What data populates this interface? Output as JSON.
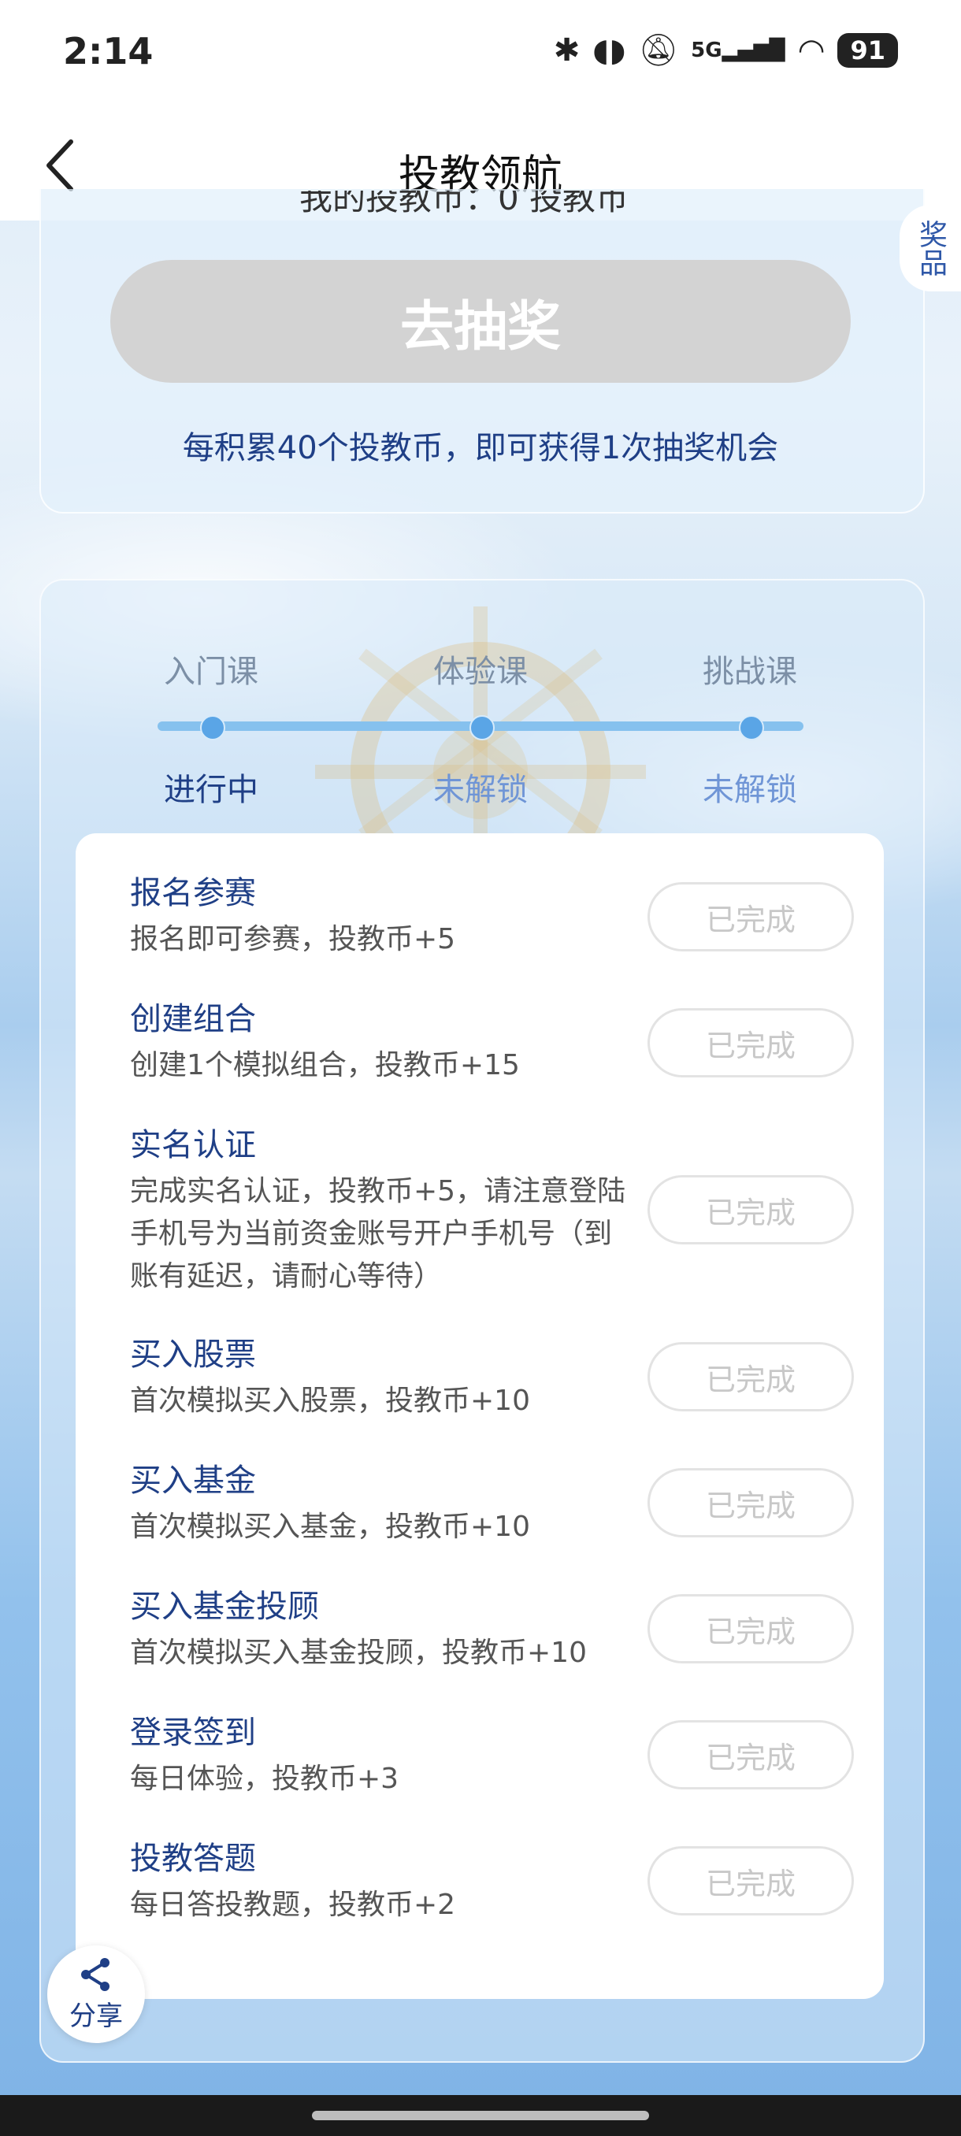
{
  "status_bar": {
    "time": "2:14",
    "icons": [
      "bluetooth-icon",
      "earbuds-icon",
      "mute-icon",
      "5g-signal-icon",
      "wifi-icon"
    ],
    "network": "5G",
    "battery": "91"
  },
  "navbar": {
    "title": "投教领航",
    "back_icon": "chevron-left-icon"
  },
  "draw": {
    "button_label": "去抽奖",
    "tip": "每积累40个投教币，即可获得1次抽奖机会",
    "clipped_text": "我的投教币：0 投教币",
    "prize_tab": "奖品"
  },
  "steps": [
    {
      "label": "入门课",
      "status": "进行中"
    },
    {
      "label": "体验课",
      "status": "未解锁"
    },
    {
      "label": "挑战课",
      "status": "未解锁"
    }
  ],
  "tasks": [
    {
      "title": "报名参赛",
      "desc": "报名即可参赛，投教币+5",
      "button": "已完成"
    },
    {
      "title": "创建组合",
      "desc": "创建1个模拟组合，投教币+15",
      "button": "已完成"
    },
    {
      "title": "实名认证",
      "desc": "完成实名认证，投教币+5，请注意登陆手机号为当前资金账号开户手机号（到账有延迟，请耐心等待）",
      "button": "已完成"
    },
    {
      "title": "买入股票",
      "desc": "首次模拟买入股票，投教币+10",
      "button": "已完成"
    },
    {
      "title": "买入基金",
      "desc": "首次模拟买入基金，投教币+10",
      "button": "已完成"
    },
    {
      "title": "买入基金投顾",
      "desc": "首次模拟买入基金投顾，投教币+10",
      "button": "已完成"
    },
    {
      "title": "登录签到",
      "desc": "每日体验，投教币+3",
      "button": "已完成"
    },
    {
      "title": "投教答题",
      "desc": "每日答投教题，投教币+2",
      "button": "已完成"
    }
  ],
  "share": {
    "label": "分享"
  },
  "colors": {
    "accent": "#1f3f86",
    "locked": "#6f95d6",
    "track": "#86c1ee"
  }
}
